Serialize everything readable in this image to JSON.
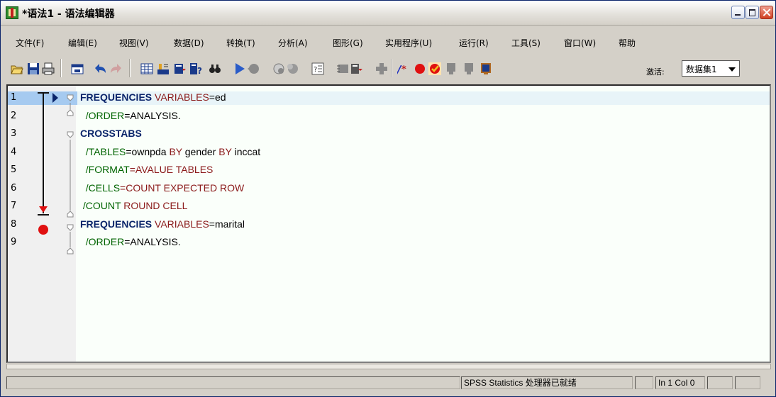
{
  "window": {
    "title": "*语法1 - 语法编辑器"
  },
  "menus": [
    {
      "label": "文件(F)"
    },
    {
      "label": "编辑(E)"
    },
    {
      "label": "视图(V)"
    },
    {
      "label": "数据(D)"
    },
    {
      "label": "转换(T)"
    },
    {
      "label": "分析(A)"
    },
    {
      "label": "图形(G)"
    },
    {
      "label": "实用程序(U)"
    },
    {
      "label": "运行(R)"
    },
    {
      "label": "工具(S)"
    },
    {
      "label": "窗口(W)"
    },
    {
      "label": "帮助"
    }
  ],
  "toolbar": {
    "active_label": "激活:",
    "dataset_value": "数据集1",
    "icons": [
      "open-folder-icon",
      "save-icon",
      "print-icon",
      "recall-dialog-icon",
      "undo-icon",
      "redo-icon",
      "goto-case-icon",
      "goto-variable-icon",
      "variables-icon",
      "use-sets-icon",
      "find-icon",
      "run-icon",
      "stop-icon",
      "run-to-end-icon",
      "step-icon",
      "syntax-help-icon",
      "bookmark-icon",
      "next-bookmark-icon",
      "add-icon",
      "comment-icon",
      "breakpoint-icon",
      "toggle-validation-icon",
      "clear-breakpoint-icon",
      "clear-bookmark-icon",
      "bookmark-list-icon"
    ]
  },
  "editor": {
    "lines": [
      {
        "num": "1",
        "segments": [
          {
            "t": "FREQUENCIES",
            "c": "kw"
          },
          {
            "t": " VARIABLES",
            "c": "sub"
          },
          {
            "t": "=ed",
            "c": "plain"
          }
        ]
      },
      {
        "num": "2",
        "segments": [
          {
            "t": "  /ORDER",
            "c": "val"
          },
          {
            "t": "=ANALYSIS.",
            "c": "plain"
          }
        ]
      },
      {
        "num": "3",
        "segments": [
          {
            "t": "CROSSTABS",
            "c": "kw"
          }
        ]
      },
      {
        "num": "4",
        "segments": [
          {
            "t": "  /TABLES",
            "c": "val"
          },
          {
            "t": "=ownpda ",
            "c": "plain"
          },
          {
            "t": "BY",
            "c": "sub"
          },
          {
            "t": " gender ",
            "c": "plain"
          },
          {
            "t": "BY",
            "c": "sub"
          },
          {
            "t": " inccat",
            "c": "plain"
          }
        ]
      },
      {
        "num": "5",
        "segments": [
          {
            "t": "  /FORMAT",
            "c": "val"
          },
          {
            "t": "=AVALUE TABLES",
            "c": "sub"
          }
        ]
      },
      {
        "num": "6",
        "segments": [
          {
            "t": "  /CELLS",
            "c": "val"
          },
          {
            "t": "=COUNT EXPECTED ROW",
            "c": "sub"
          }
        ]
      },
      {
        "num": "7",
        "segments": [
          {
            "t": " /COUNT",
            "c": "val"
          },
          {
            "t": " ROUND CELL",
            "c": "sub"
          }
        ]
      },
      {
        "num": "8",
        "segments": [
          {
            "t": "FREQUENCIES",
            "c": "kw"
          },
          {
            "t": " VARIABLES",
            "c": "sub"
          },
          {
            "t": "=marital",
            "c": "plain"
          }
        ]
      },
      {
        "num": "9",
        "segments": [
          {
            "t": "  /ORDER",
            "c": "val"
          },
          {
            "t": "=ANALYSIS.",
            "c": "plain"
          }
        ]
      }
    ]
  },
  "status": {
    "processor": "SPSS Statistics  处理器已就绪",
    "position": "In 1 Col 0"
  },
  "colors": {
    "keyword": "#0a246a",
    "subcommand": "#8b1a1a",
    "value": "#006400",
    "breakpoint": "#e01010",
    "selected_line": "#a6caf0"
  }
}
